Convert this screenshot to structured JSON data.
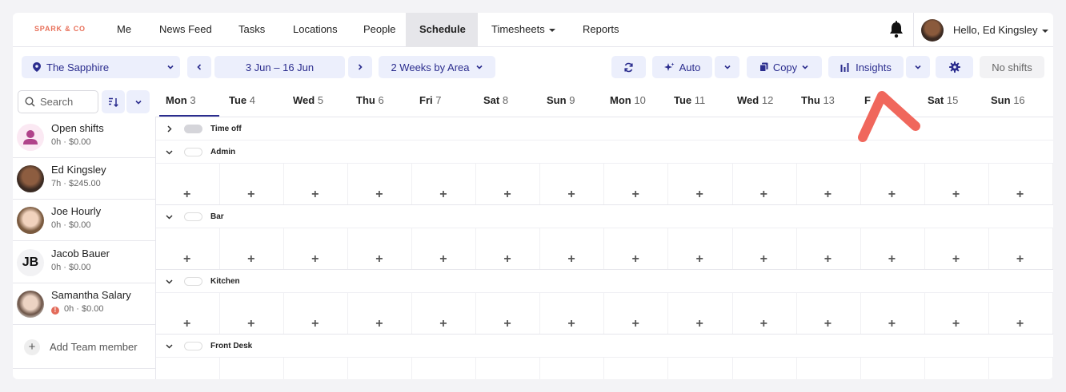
{
  "nav": {
    "logo": "SPARK & CO",
    "links": [
      "Me",
      "News Feed",
      "Tasks",
      "Locations",
      "People",
      "Schedule",
      "Timesheets",
      "Reports"
    ],
    "active": "Schedule",
    "greeting": "Hello, Ed Kingsley"
  },
  "toolbar": {
    "location": "The Sapphire",
    "date_range": "3 Jun – 16 Jun",
    "view": "2 Weeks by Area",
    "auto_label": "Auto",
    "copy_label": "Copy",
    "insights_label": "Insights",
    "no_shifts_label": "No shifts"
  },
  "search": {
    "placeholder": "Search"
  },
  "days": [
    {
      "d": "Mon",
      "n": "3"
    },
    {
      "d": "Tue",
      "n": "4"
    },
    {
      "d": "Wed",
      "n": "5"
    },
    {
      "d": "Thu",
      "n": "6"
    },
    {
      "d": "Fri",
      "n": "7"
    },
    {
      "d": "Sat",
      "n": "8"
    },
    {
      "d": "Sun",
      "n": "9"
    },
    {
      "d": "Mon",
      "n": "10"
    },
    {
      "d": "Tue",
      "n": "11"
    },
    {
      "d": "Wed",
      "n": "12"
    },
    {
      "d": "Thu",
      "n": "13"
    },
    {
      "d": "F",
      "n": ""
    },
    {
      "d": "Sat",
      "n": "15"
    },
    {
      "d": "Sun",
      "n": "16"
    }
  ],
  "members": [
    {
      "name": "Open shifts",
      "sub": "0h · $0.00"
    },
    {
      "name": "Ed Kingsley",
      "sub": "7h · $245.00"
    },
    {
      "name": "Joe Hourly",
      "sub": "0h · $0.00"
    },
    {
      "name": "Jacob Bauer",
      "sub": "0h · $0.00",
      "initials": "JB"
    },
    {
      "name": "Samantha Salary",
      "sub": "0h · $0.00"
    }
  ],
  "add_member_label": "Add Team member",
  "areas": [
    "Time off",
    "Admin",
    "Bar",
    "Kitchen",
    "Front Desk"
  ],
  "add_symbol": "+",
  "colors": {
    "accent": "#2b2d8e",
    "button_bg": "#eceffc",
    "logo": "#e8705a",
    "annotation": "#f0675c"
  }
}
